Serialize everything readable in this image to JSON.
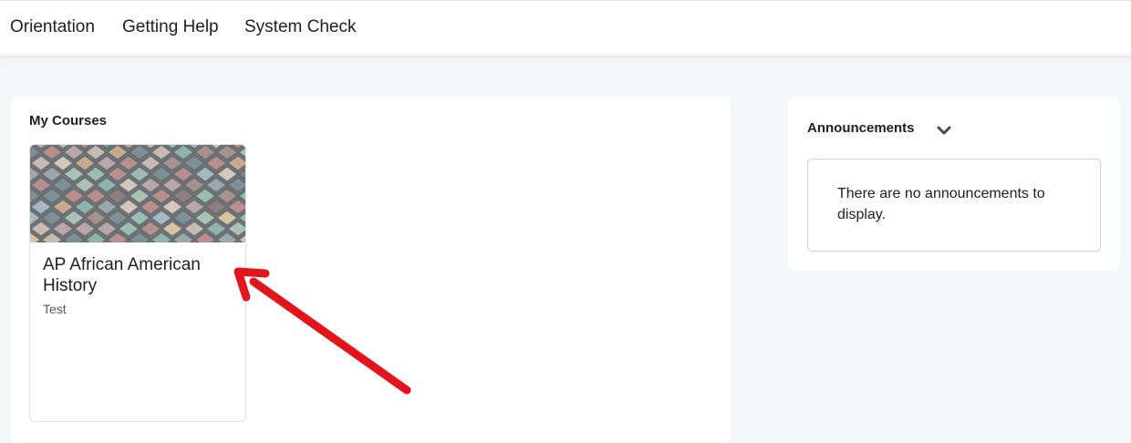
{
  "nav": {
    "items": [
      "Orientation",
      "Getting Help",
      "System Check"
    ]
  },
  "courses": {
    "title": "My Courses",
    "cards": [
      {
        "name": "AP African American History",
        "code": "Test"
      }
    ]
  },
  "announcements": {
    "title": "Announcements",
    "empty_message": "There are no announcements to display."
  },
  "icons": {
    "collapse": "chevron-down-icon",
    "annotation": "red-arrow-annotation"
  },
  "colors": {
    "background": "#f5f6f8",
    "panel": "#ffffff",
    "annotation_arrow": "#e3141b"
  }
}
